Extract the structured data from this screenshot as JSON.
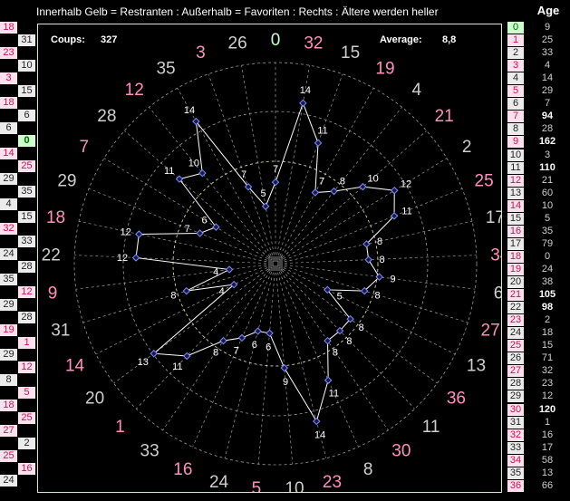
{
  "header": {
    "title": "Innerhalb Gelb = Restranten : Außerhalb = Favoriten : Rechts : Ältere werden heller",
    "age_title": "Age"
  },
  "stats": {
    "coups_label": "Coups:",
    "coups_value": "327",
    "average_label": "Average:",
    "average_value": "8,8"
  },
  "colors": {
    "red_number": "#ff8fbf",
    "black_number": "#cfcfcf",
    "zero_number": "#ccffcc",
    "polygon": "#ffffff",
    "node": "#7f8cff",
    "grid": "#9a9a9a",
    "yellow_ring": "#d8d8a0",
    "panel_border": "#cfe8cf"
  },
  "wheel": [
    {
      "number": "0",
      "color": "green",
      "count": "7"
    },
    {
      "number": "32",
      "color": "red",
      "count": "14"
    },
    {
      "number": "15",
      "color": "black",
      "count": "11"
    },
    {
      "number": "19",
      "color": "red",
      "count": "7"
    },
    {
      "number": "4",
      "color": "black",
      "count": "8"
    },
    {
      "number": "21",
      "color": "red",
      "count": "10"
    },
    {
      "number": "2",
      "color": "black",
      "count": "12"
    },
    {
      "number": "25",
      "color": "red",
      "count": "11"
    },
    {
      "number": "17",
      "color": "black",
      "count": "8"
    },
    {
      "number": "34",
      "color": "red",
      "count": "8"
    },
    {
      "number": "6",
      "color": "black",
      "count": "9"
    },
    {
      "number": "27",
      "color": "red",
      "count": "8"
    },
    {
      "number": "13",
      "color": "black",
      "count": "5"
    },
    {
      "number": "36",
      "color": "red",
      "count": "8"
    },
    {
      "number": "11",
      "color": "black",
      "count": "8"
    },
    {
      "number": "30",
      "color": "red",
      "count": "8"
    },
    {
      "number": "8",
      "color": "black",
      "count": "11"
    },
    {
      "number": "23",
      "color": "red",
      "count": "14"
    },
    {
      "number": "10",
      "color": "black",
      "count": "9"
    },
    {
      "number": "5",
      "color": "red",
      "count": "6"
    },
    {
      "number": "24",
      "color": "black",
      "count": "6"
    },
    {
      "number": "16",
      "color": "red",
      "count": "7"
    },
    {
      "number": "33",
      "color": "black",
      "count": "8"
    },
    {
      "number": "1",
      "color": "red",
      "count": "11"
    },
    {
      "number": "20",
      "color": "black",
      "count": "13"
    },
    {
      "number": "14",
      "color": "red",
      "count": "4"
    },
    {
      "number": "31",
      "color": "black",
      "count": "8"
    },
    {
      "number": "9",
      "color": "red",
      "count": "4"
    },
    {
      "number": "22",
      "color": "black",
      "count": "12"
    },
    {
      "number": "18",
      "color": "red",
      "count": "12"
    },
    {
      "number": "29",
      "color": "black",
      "count": "7"
    },
    {
      "number": "7",
      "color": "red",
      "count": "6"
    },
    {
      "number": "28",
      "color": "black",
      "count": "11"
    },
    {
      "number": "12",
      "color": "red",
      "count": "10"
    },
    {
      "number": "35",
      "color": "black",
      "count": "14"
    },
    {
      "number": "3",
      "color": "red",
      "count": "7"
    },
    {
      "number": "26",
      "color": "black",
      "count": "5"
    }
  ],
  "history": [
    {
      "value": "18",
      "side": "left",
      "color": "red"
    },
    {
      "value": "31",
      "side": "right",
      "color": "black"
    },
    {
      "value": "23",
      "side": "left",
      "color": "red"
    },
    {
      "value": "10",
      "side": "right",
      "color": "black"
    },
    {
      "value": "3",
      "side": "left",
      "color": "red"
    },
    {
      "value": "15",
      "side": "right",
      "color": "black"
    },
    {
      "value": "18",
      "side": "left",
      "color": "red"
    },
    {
      "value": "6",
      "side": "right",
      "color": "black"
    },
    {
      "value": "6",
      "side": "left",
      "color": "black"
    },
    {
      "value": "0",
      "side": "right",
      "color": "green"
    },
    {
      "value": "14",
      "side": "left",
      "color": "red"
    },
    {
      "value": "25",
      "side": "right",
      "color": "red"
    },
    {
      "value": "29",
      "side": "left",
      "color": "black"
    },
    {
      "value": "35",
      "side": "right",
      "color": "black"
    },
    {
      "value": "4",
      "side": "left",
      "color": "black"
    },
    {
      "value": "15",
      "side": "right",
      "color": "black"
    },
    {
      "value": "32",
      "side": "left",
      "color": "red"
    },
    {
      "value": "33",
      "side": "right",
      "color": "black"
    },
    {
      "value": "24",
      "side": "left",
      "color": "black"
    },
    {
      "value": "28",
      "side": "right",
      "color": "black"
    },
    {
      "value": "35",
      "side": "left",
      "color": "black"
    },
    {
      "value": "12",
      "side": "right",
      "color": "red"
    },
    {
      "value": "29",
      "side": "left",
      "color": "black"
    },
    {
      "value": "28",
      "side": "right",
      "color": "black"
    },
    {
      "value": "19",
      "side": "left",
      "color": "red"
    },
    {
      "value": "1",
      "side": "right",
      "color": "red"
    },
    {
      "value": "29",
      "side": "left",
      "color": "black"
    },
    {
      "value": "12",
      "side": "right",
      "color": "red"
    },
    {
      "value": "8",
      "side": "left",
      "color": "black"
    },
    {
      "value": "5",
      "side": "right",
      "color": "red"
    },
    {
      "value": "18",
      "side": "left",
      "color": "red"
    },
    {
      "value": "25",
      "side": "right",
      "color": "red"
    },
    {
      "value": "27",
      "side": "left",
      "color": "red"
    },
    {
      "value": "2",
      "side": "right",
      "color": "black"
    },
    {
      "value": "25",
      "side": "left",
      "color": "red"
    },
    {
      "value": "16",
      "side": "right",
      "color": "red"
    },
    {
      "value": "24",
      "side": "left",
      "color": "black"
    }
  ],
  "age_table": [
    {
      "number": "0",
      "age": "9",
      "color": "green"
    },
    {
      "number": "1",
      "age": "25",
      "color": "red"
    },
    {
      "number": "2",
      "age": "33",
      "color": "black"
    },
    {
      "number": "3",
      "age": "4",
      "color": "red"
    },
    {
      "number": "4",
      "age": "14",
      "color": "black"
    },
    {
      "number": "5",
      "age": "29",
      "color": "red"
    },
    {
      "number": "6",
      "age": "7",
      "color": "black"
    },
    {
      "number": "7",
      "age": "94",
      "color": "red"
    },
    {
      "number": "8",
      "age": "28",
      "color": "black"
    },
    {
      "number": "9",
      "age": "162",
      "color": "red"
    },
    {
      "number": "10",
      "age": "3",
      "color": "black"
    },
    {
      "number": "11",
      "age": "110",
      "color": "black"
    },
    {
      "number": "12",
      "age": "21",
      "color": "red"
    },
    {
      "number": "13",
      "age": "60",
      "color": "black"
    },
    {
      "number": "14",
      "age": "10",
      "color": "red"
    },
    {
      "number": "15",
      "age": "5",
      "color": "black"
    },
    {
      "number": "16",
      "age": "35",
      "color": "red"
    },
    {
      "number": "17",
      "age": "79",
      "color": "black"
    },
    {
      "number": "18",
      "age": "0",
      "color": "red"
    },
    {
      "number": "19",
      "age": "24",
      "color": "red"
    },
    {
      "number": "20",
      "age": "38",
      "color": "black"
    },
    {
      "number": "21",
      "age": "105",
      "color": "red"
    },
    {
      "number": "22",
      "age": "98",
      "color": "black"
    },
    {
      "number": "23",
      "age": "2",
      "color": "red"
    },
    {
      "number": "24",
      "age": "18",
      "color": "black"
    },
    {
      "number": "25",
      "age": "15",
      "color": "red"
    },
    {
      "number": "26",
      "age": "71",
      "color": "black"
    },
    {
      "number": "27",
      "age": "32",
      "color": "red"
    },
    {
      "number": "28",
      "age": "23",
      "color": "black"
    },
    {
      "number": "29",
      "age": "12",
      "color": "black"
    },
    {
      "number": "30",
      "age": "120",
      "color": "red"
    },
    {
      "number": "31",
      "age": "1",
      "color": "black"
    },
    {
      "number": "32",
      "age": "16",
      "color": "red"
    },
    {
      "number": "33",
      "age": "17",
      "color": "black"
    },
    {
      "number": "34",
      "age": "58",
      "color": "red"
    },
    {
      "number": "35",
      "age": "13",
      "color": "black"
    },
    {
      "number": "36",
      "age": "66",
      "color": "red"
    }
  ]
}
